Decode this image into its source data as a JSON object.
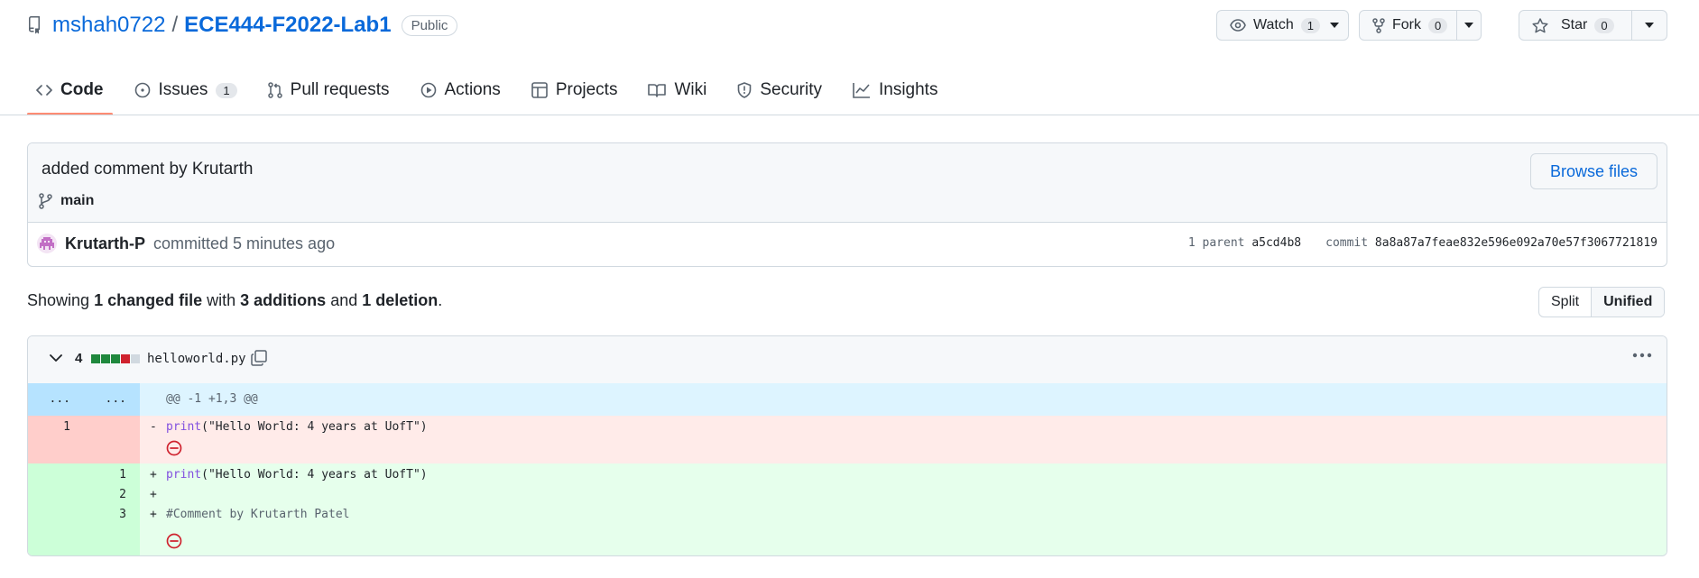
{
  "repo": {
    "owner": "mshah0722",
    "separator": "/",
    "name": "ECE444-F2022-Lab1",
    "visibility": "Public"
  },
  "actions": {
    "watch": {
      "label": "Watch",
      "count": "1"
    },
    "fork": {
      "label": "Fork",
      "count": "0"
    },
    "star": {
      "label": "Star",
      "count": "0"
    }
  },
  "tabs": [
    {
      "label": "Code",
      "icon": "code-icon",
      "active": true
    },
    {
      "label": "Issues",
      "icon": "issue-opened-icon",
      "count": "1"
    },
    {
      "label": "Pull requests",
      "icon": "git-pull-request-icon"
    },
    {
      "label": "Actions",
      "icon": "play-icon"
    },
    {
      "label": "Projects",
      "icon": "table-icon"
    },
    {
      "label": "Wiki",
      "icon": "book-icon"
    },
    {
      "label": "Security",
      "icon": "shield-icon"
    },
    {
      "label": "Insights",
      "icon": "graph-icon"
    }
  ],
  "commit": {
    "message": "added comment by Krutarth",
    "branch": "main",
    "browse_label": "Browse files",
    "author": "Krutarth-P",
    "action_text": "committed 5 minutes ago",
    "parent_label": "1 parent",
    "parent_sha": "a5cd4b8",
    "commit_label": "commit",
    "sha": "8a8a87a7feae832e596e092a70e57f3067721819"
  },
  "summary": {
    "showing": "Showing",
    "changed_files": "1 changed file",
    "with": "with",
    "additions": "3 additions",
    "and": "and",
    "deletions": "1 deletion",
    "end": "."
  },
  "view_toggle": {
    "split": "Split",
    "unified": "Unified",
    "selected": "Unified"
  },
  "file": {
    "change_count": "4",
    "diffstat_colors": [
      "#1f883d",
      "#1f883d",
      "#1f883d",
      "#cf222e",
      "#d1d9e0"
    ],
    "name": "helloworld.py",
    "hunk": {
      "old_ln": "...",
      "new_ln": "...",
      "header": "@@ -1 +1,3 @@"
    },
    "lines": [
      {
        "type": "del",
        "old": "1",
        "new": "",
        "sign": "-",
        "kw": "print",
        "rest": "(\"Hello World: 4 years at UofT\")"
      },
      {
        "type": "add",
        "old": "",
        "new": "1",
        "sign": "+",
        "kw": "print",
        "rest": "(\"Hello World: 4 years at UofT\")"
      },
      {
        "type": "add",
        "old": "",
        "new": "2",
        "sign": "+",
        "kw": "",
        "rest": ""
      },
      {
        "type": "add",
        "old": "",
        "new": "3",
        "sign": "+",
        "kw": "",
        "rest": "#Comment by Krutarth Patel"
      }
    ]
  },
  "colors": {
    "link": "#0969da",
    "active_tab": "#fd8c73",
    "add_bg": "#e6ffec",
    "del_bg": "#ffebe9",
    "hunk_bg": "#ddf4ff",
    "no_eol": "#cf222e"
  }
}
